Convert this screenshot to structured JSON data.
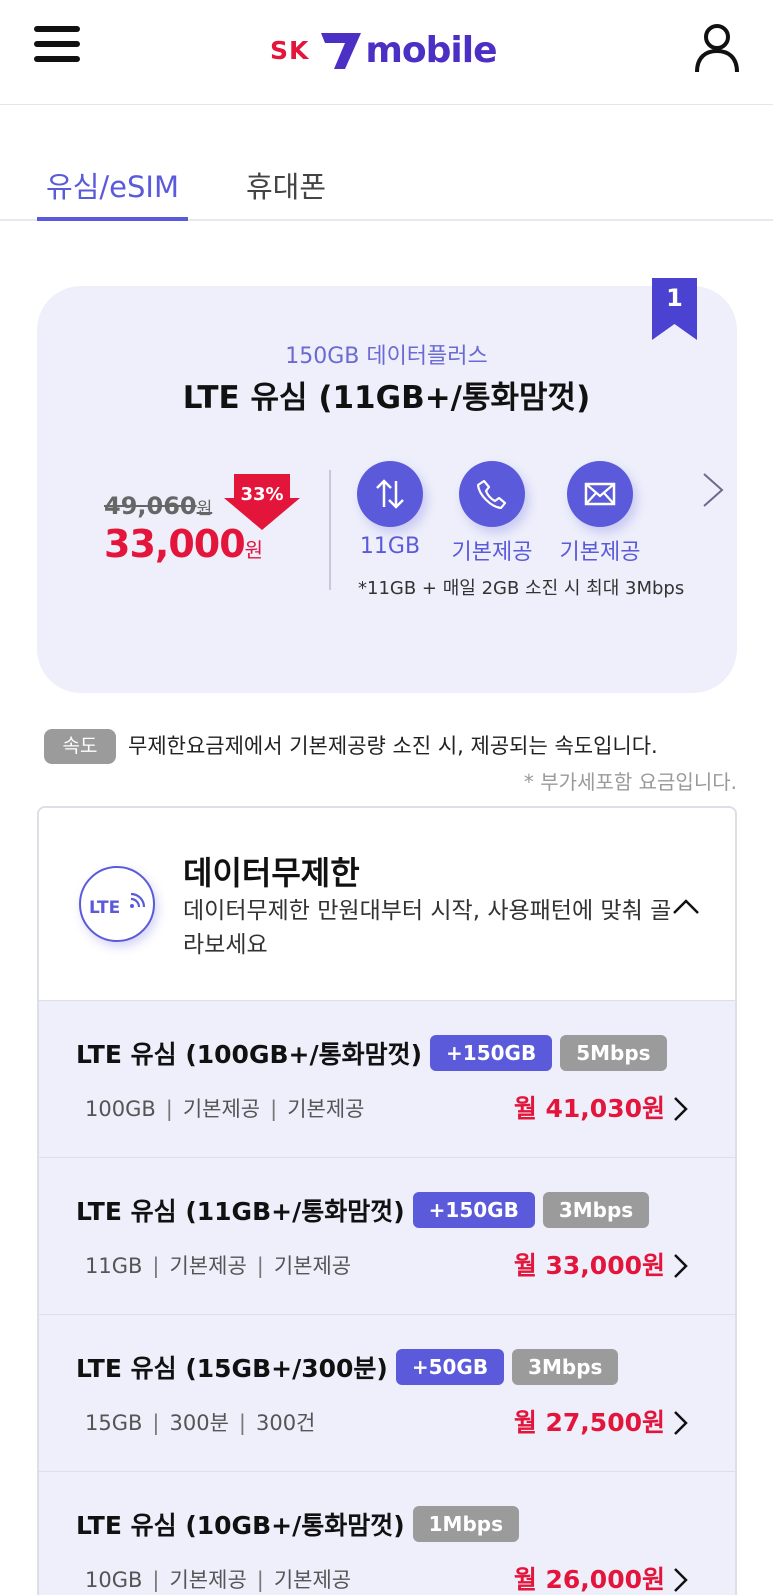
{
  "header": {
    "logo_sk": "SK",
    "logo_mobile": "mobile"
  },
  "tabs": [
    {
      "label": "유심/eSIM",
      "active": true
    },
    {
      "label": "휴대폰",
      "active": false
    }
  ],
  "featured": {
    "rank": "1",
    "subtitle": "150GB 데이터플러스",
    "title": "LTE 유심 (11GB+/통화맘껏)",
    "original_price": "49,060",
    "original_unit": "원",
    "discount": "33%",
    "price": "33,000",
    "price_unit": "원",
    "features": [
      {
        "icon": "data-arrows-icon",
        "label": "11GB"
      },
      {
        "icon": "phone-icon",
        "label": "기본제공"
      },
      {
        "icon": "mail-icon",
        "label": "기본제공"
      }
    ],
    "note": "*11GB + 매일 2GB 소진 시 최대 3Mbps"
  },
  "speed_note": {
    "badge": "속도",
    "text": "무제한요금제에서 기본제공량 소진 시, 제공되는 속도입니다.",
    "vat": "* 부가세포함 요금입니다."
  },
  "category": {
    "logo_text": "LTE",
    "title": "데이터무제한",
    "description": "데이터무제한 만원대부터 시작, 사용패턴에 맞춰 골라보세요"
  },
  "plans": [
    {
      "name": "LTE 유심 (100GB+/통화맘껏)",
      "tags": [
        {
          "text": "+150GB",
          "style": "blue"
        },
        {
          "text": "5Mbps",
          "style": "gray"
        }
      ],
      "data": "100GB",
      "voice": "기본제공",
      "sms": "기본제공",
      "price": "월 41,030원"
    },
    {
      "name": "LTE 유심 (11GB+/통화맘껏)",
      "tags": [
        {
          "text": "+150GB",
          "style": "blue"
        },
        {
          "text": "3Mbps",
          "style": "gray"
        }
      ],
      "data": "11GB",
      "voice": "기본제공",
      "sms": "기본제공",
      "price": "월 33,000원"
    },
    {
      "name": "LTE 유심 (15GB+/300분)",
      "tags": [
        {
          "text": "+50GB",
          "style": "blue"
        },
        {
          "text": "3Mbps",
          "style": "gray"
        }
      ],
      "data": "15GB",
      "voice": "300분",
      "sms": "300건",
      "price": "월 27,500원"
    },
    {
      "name": "LTE 유심 (10GB+/통화맘껏)",
      "tags": [
        {
          "text": "1Mbps",
          "style": "gray"
        }
      ],
      "data": "10GB",
      "voice": "기본제공",
      "sms": "기본제공",
      "price": "월 26,000원"
    }
  ],
  "colors": {
    "accent": "#5a5adb",
    "brand": "#4c2fc4",
    "price": "#e3153b",
    "card_bg": "#eeeffb"
  }
}
